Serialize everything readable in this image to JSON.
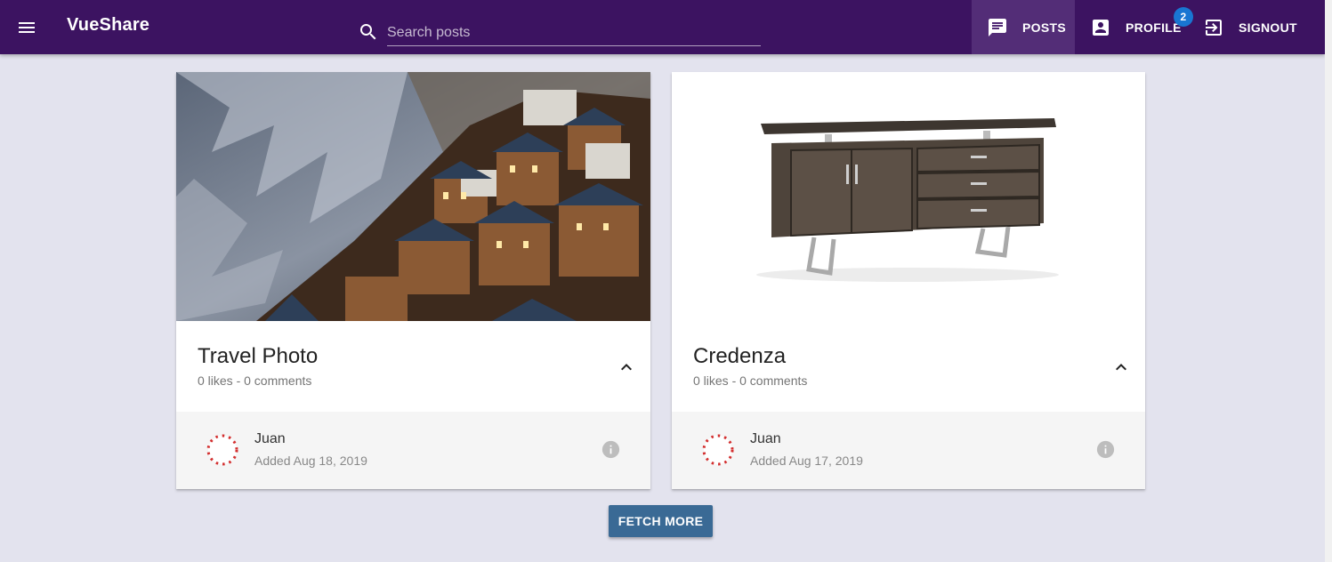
{
  "app": {
    "brand": "VueShare"
  },
  "toolbar": {
    "menu_icon": "menu-icon",
    "search": {
      "placeholder": "Search posts",
      "value": "",
      "icon": "search-icon"
    },
    "nav": [
      {
        "label": "POSTS",
        "icon": "chat-icon",
        "active": true
      },
      {
        "label": "PROFILE",
        "icon": "account-box-icon",
        "badge": "2"
      },
      {
        "label": "SIGNOUT",
        "icon": "exit-icon"
      }
    ],
    "colors": {
      "background": "#3c1361",
      "active": "#532d77",
      "badge": "#1976d2"
    }
  },
  "posts": [
    {
      "title": "Travel Photo",
      "stats": "0 likes - 0 comments",
      "author": "Juan",
      "added": "Added Aug 18, 2019",
      "image": "mountain-village-photo",
      "expand_icon": "chevron-up-icon",
      "info_icon": "info-icon"
    },
    {
      "title": "Credenza",
      "stats": "0 likes - 0 comments",
      "author": "Juan",
      "added": "Added Aug 17, 2019",
      "image": "wooden-credenza-photo",
      "expand_icon": "chevron-up-icon",
      "info_icon": "info-icon"
    }
  ],
  "actions": {
    "fetch_more": "FETCH MORE"
  },
  "colors": {
    "page_background": "#e3e3ee",
    "button": "#3a6a95"
  }
}
